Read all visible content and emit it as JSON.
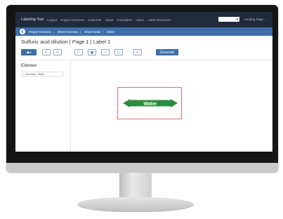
{
  "app": {
    "brand": "Labeling Tool",
    "nav_links": [
      "Logout",
      "Project Overview",
      "Customer",
      "About",
      "Translation",
      "Users",
      "Label Dimension"
    ],
    "language_select": "",
    "user_link": "Landing Page ..."
  },
  "breadcrumb": {
    "items": [
      "Project Overview",
      "Sheet Overview",
      "Sheet Detail",
      "Editor"
    ],
    "separator": "|"
  },
  "page": {
    "title": "Sulfuric acid dilution | Page 1 | Label 1"
  },
  "toolbar": {
    "primary_button_label": "◀ ▸",
    "icon_buttons": [
      "↶",
      "↷",
      "☐",
      "▣",
      "○",
      "▢",
      "+"
    ],
    "save_button_label": "Generate"
  },
  "layers": {
    "heading": "Ebenen",
    "items": [
      "1. Schriftart - Water"
    ]
  },
  "canvas": {
    "label_text": "Water",
    "label_color": "#2e8b3e",
    "frame_color": "#e06a6a"
  }
}
